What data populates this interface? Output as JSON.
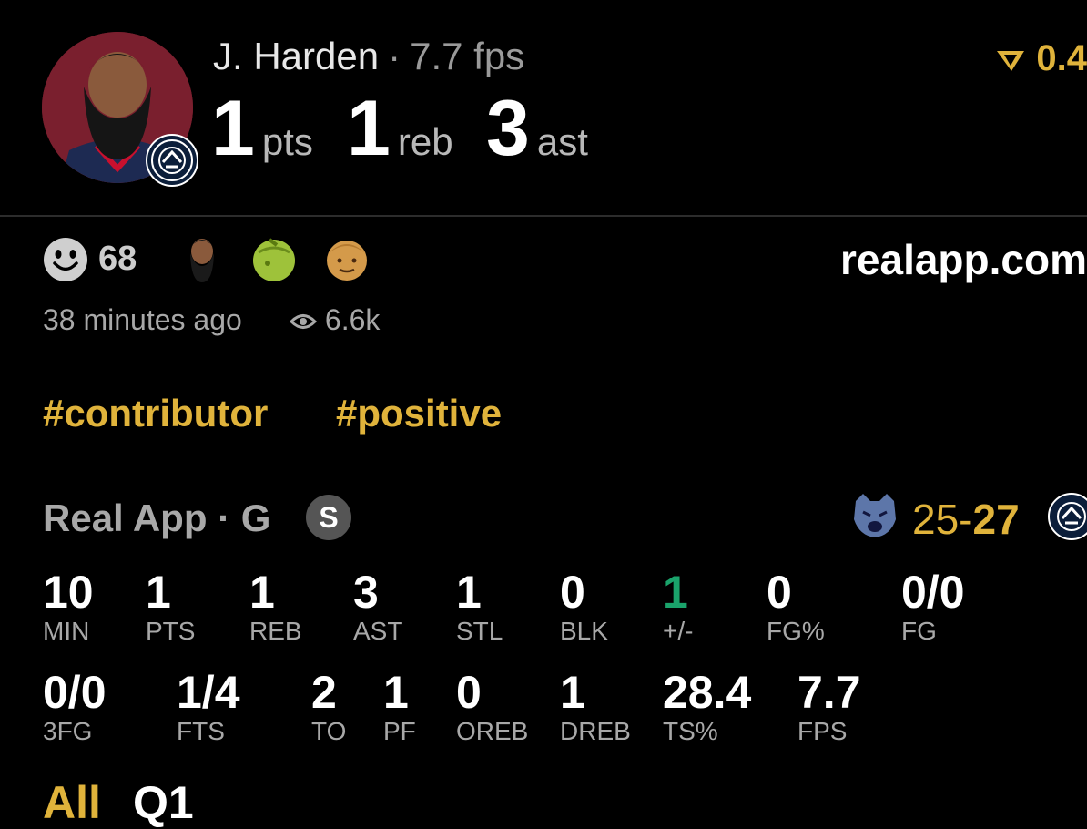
{
  "player": {
    "name": "J. Harden",
    "fps_label": "7.7 fps",
    "pts": "1",
    "pts_unit": "pts",
    "reb": "1",
    "reb_unit": "reb",
    "ast": "3",
    "ast_unit": "ast"
  },
  "top_right_value": "0.4",
  "reactions": {
    "count": "68"
  },
  "site": "realapp.com",
  "post": {
    "time_ago": "38 minutes ago",
    "views": "6.6k"
  },
  "tags": [
    "#contributor",
    "#positive"
  ],
  "source": {
    "label": "Real App · G",
    "badge": "S"
  },
  "game": {
    "score_left": "25-",
    "score_right": "27"
  },
  "stats_row1": [
    {
      "value": "10",
      "label": "MIN"
    },
    {
      "value": "1",
      "label": "PTS"
    },
    {
      "value": "1",
      "label": "REB"
    },
    {
      "value": "3",
      "label": "AST"
    },
    {
      "value": "1",
      "label": "STL"
    },
    {
      "value": "0",
      "label": "BLK"
    },
    {
      "value": "1",
      "label": "+/-"
    },
    {
      "value": "0",
      "label": "FG%"
    },
    {
      "value": "0/0",
      "label": "FG"
    }
  ],
  "stats_row2": [
    {
      "value": "0/0",
      "label": "3FG"
    },
    {
      "value": "1/4",
      "label": "FTS"
    },
    {
      "value": "2",
      "label": "TO"
    },
    {
      "value": "1",
      "label": "PF"
    },
    {
      "value": "0",
      "label": "OREB"
    },
    {
      "value": "1",
      "label": "DREB"
    },
    {
      "value": "28.4",
      "label": "TS%"
    },
    {
      "value": "7.7",
      "label": "FPS"
    }
  ],
  "tabs": [
    "All",
    "Q1"
  ],
  "colors": {
    "accent": "#e0b33b",
    "positive": "#1aa36b",
    "muted": "#a8a8a8"
  }
}
